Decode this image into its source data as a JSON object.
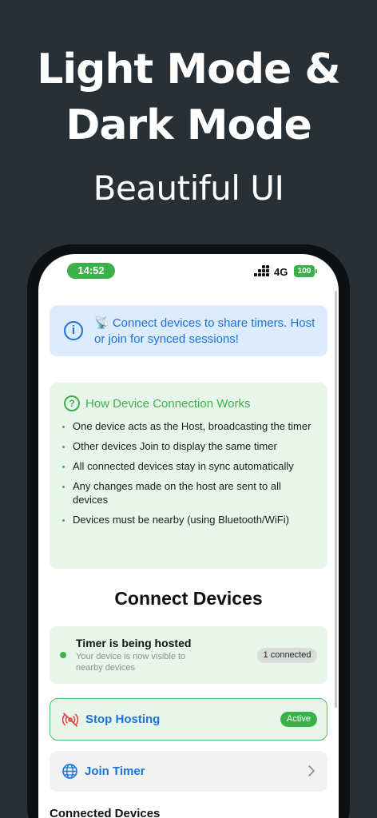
{
  "promo": {
    "headline_line1": "Light Mode &",
    "headline_line2": "Dark Mode",
    "subheadline": "Beautiful UI"
  },
  "status_bar": {
    "time": "14:52",
    "network": "4G",
    "battery": "100"
  },
  "info_banner": {
    "icon": "info-icon",
    "text": "📡 Connect devices to share timers. Host or join for synced sessions!"
  },
  "how_it_works": {
    "icon": "question-circle-icon",
    "title": "How Device Connection Works",
    "items": [
      "One device acts as the Host, broadcasting the timer",
      "Other devices Join to display the same timer",
      "All connected devices stay in sync automatically",
      "Any changes made on the host are sent to all devices",
      "Devices must be nearby (using Bluetooth/WiFi)"
    ]
  },
  "connect": {
    "title": "Connect Devices",
    "hosted_card": {
      "title": "Timer is being hosted",
      "subtitle": "Your device is now visible to nearby devices",
      "badge": "1 connected"
    },
    "stop_hosting": {
      "label": "Stop Hosting",
      "badge": "Active",
      "icon": "broadcast-off-icon"
    },
    "join_timer": {
      "label": "Join Timer",
      "icon": "globe-icon"
    },
    "connected_heading": "Connected Devices"
  },
  "colors": {
    "background": "#293035",
    "accent_green": "#3bb14a",
    "accent_blue": "#1a73d9",
    "info_bg": "#dcebfd",
    "green_bg": "#e8f5ea"
  }
}
